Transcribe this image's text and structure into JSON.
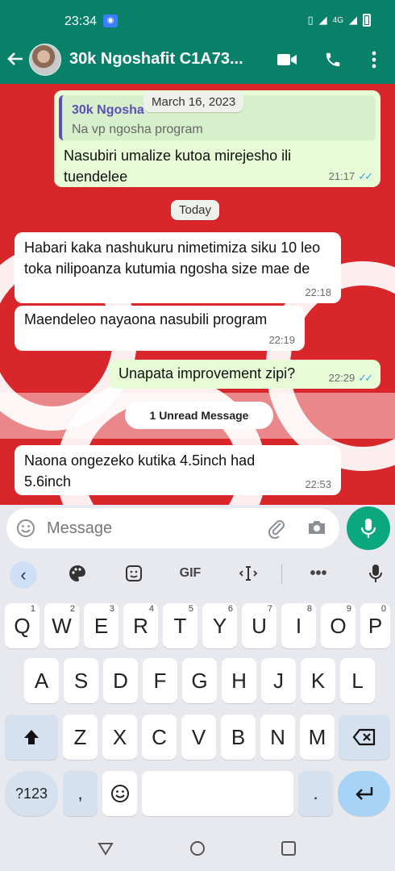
{
  "status": {
    "time": "23:34",
    "network": "4G"
  },
  "header": {
    "title": "30k Ngoshafit C1A73..."
  },
  "chat": {
    "quoted": {
      "name": "30k Ngosha",
      "text": "Na vp ngosha program"
    },
    "date_pill": "March 16, 2023",
    "msg1": {
      "text": "Nasubiri umalize kutoa mirejesho ili tuendelee",
      "time": "21:17"
    },
    "today_pill": "Today",
    "msg2": {
      "text": "Habari kaka nashukuru nimetimiza siku 10 leo toka nilipoanza kutumia ngosha size mae de",
      "time": "22:18"
    },
    "msg3": {
      "text": "Maendeleo nayaona  nasubili program",
      "time": "22:19"
    },
    "msg4": {
      "text": "Unapata improvement zipi?",
      "time": "22:29"
    },
    "unread_label": "1 Unread Message",
    "msg5": {
      "text": "Naona ongezeko kutika 4.5inch had 5.6inch",
      "time": "22:53"
    }
  },
  "input": {
    "placeholder": "Message"
  },
  "keyboard": {
    "toolbar_gif": "GIF",
    "row1": [
      {
        "k": "Q",
        "n": "1"
      },
      {
        "k": "W",
        "n": "2"
      },
      {
        "k": "E",
        "n": "3"
      },
      {
        "k": "R",
        "n": "4"
      },
      {
        "k": "T",
        "n": "5"
      },
      {
        "k": "Y",
        "n": "6"
      },
      {
        "k": "U",
        "n": "7"
      },
      {
        "k": "I",
        "n": "8"
      },
      {
        "k": "O",
        "n": "9"
      },
      {
        "k": "P",
        "n": "0"
      }
    ],
    "row2": [
      "A",
      "S",
      "D",
      "F",
      "G",
      "H",
      "J",
      "K",
      "L"
    ],
    "row3": [
      "Z",
      "X",
      "C",
      "V",
      "B",
      "N",
      "M"
    ],
    "num_key": "?123",
    "comma": ",",
    "period": "."
  },
  "colors": {
    "header": "#08806a",
    "wallpaper": "#d8262a",
    "accent": "#0ba87e",
    "tick": "#39a3e6"
  }
}
